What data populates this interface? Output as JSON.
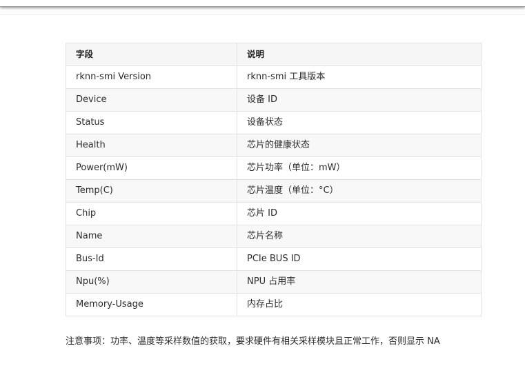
{
  "table": {
    "headers": [
      "字段",
      "说明"
    ],
    "rows": [
      {
        "field": "rknn-smi Version",
        "desc": "rknn-smi 工具版本"
      },
      {
        "field": "Device",
        "desc": "设备 ID"
      },
      {
        "field": "Status",
        "desc": "设备状态"
      },
      {
        "field": "Health",
        "desc": "芯片的健康状态"
      },
      {
        "field": "Power(mW)",
        "desc": "芯片功率（单位：mW）"
      },
      {
        "field": "Temp(C)",
        "desc": "芯片温度（单位：°C）"
      },
      {
        "field": "Chip",
        "desc": "芯片 ID"
      },
      {
        "field": "Name",
        "desc": "芯片名称"
      },
      {
        "field": "Bus-Id",
        "desc": "PCIe BUS ID"
      },
      {
        "field": "Npu(%)",
        "desc": "NPU 占用率"
      },
      {
        "field": "Memory-Usage",
        "desc": "内存占比"
      }
    ]
  },
  "note": "注意事项：功率、温度等采样数值的获取，要求硬件有相关采样模块且正常工作，否则显示 NA",
  "colors": {
    "header_bg": "#f6f6f6",
    "stripe_bg": "#f8f8f8",
    "border": "#e2e2e2",
    "text": "#2b2b2b"
  }
}
